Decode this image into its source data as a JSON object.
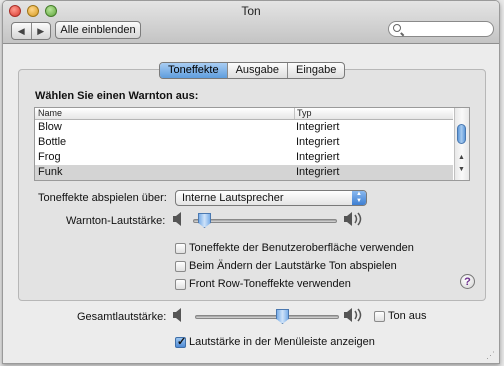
{
  "window": {
    "title": "Ton",
    "nav": {
      "back": "◀",
      "forward": "▶"
    },
    "show_all_label": "Alle einblenden",
    "search": {
      "placeholder": "",
      "value": ""
    }
  },
  "tabs": [
    {
      "label": "Toneffekte",
      "active": true
    },
    {
      "label": "Ausgabe",
      "active": false
    },
    {
      "label": "Eingabe",
      "active": false
    }
  ],
  "alert_section": {
    "heading": "Wählen Sie einen Warnton aus:",
    "columns": [
      "Name",
      "Typ"
    ],
    "rows": [
      {
        "name": "Blow",
        "type": "Integriert",
        "selected": false
      },
      {
        "name": "Bottle",
        "type": "Integriert",
        "selected": false
      },
      {
        "name": "Frog",
        "type": "Integriert",
        "selected": false
      },
      {
        "name": "Funk",
        "type": "Integriert",
        "selected": true
      }
    ]
  },
  "play_through": {
    "label": "Toneffekte abspielen über:",
    "selected": "Interne Lautsprecher"
  },
  "alert_volume": {
    "label": "Warnton-Lautstärke:",
    "level": 0.04
  },
  "checkboxes": [
    {
      "label": "Toneffekte der Benutzeroberfläche verwenden",
      "checked": false
    },
    {
      "label": "Beim Ändern der Lautstärke Ton abspielen",
      "checked": false
    },
    {
      "label": "Front Row-Toneffekte verwenden",
      "checked": false
    }
  ],
  "help_label": "?",
  "output_volume": {
    "label": "Gesamtlautstärke:",
    "level": 0.62,
    "mute_label": "Ton aus",
    "mute_checked": false
  },
  "menubar_checkbox": {
    "label": "Lautstärke in der Menüleiste anzeigen",
    "checked": true
  },
  "colors": {
    "accent": "#5f9ddd",
    "help_glyph": "#6a2c8c"
  }
}
